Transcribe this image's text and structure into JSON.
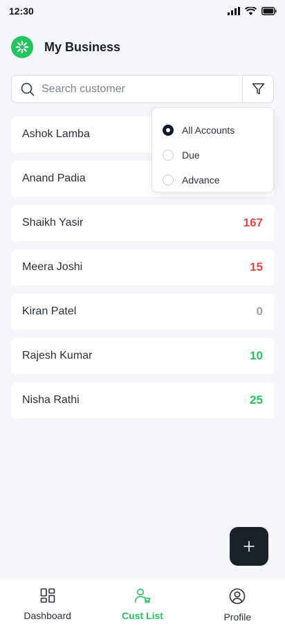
{
  "status_bar": {
    "time": "12:30"
  },
  "header": {
    "title": "My Business"
  },
  "search": {
    "placeholder": "Search customer"
  },
  "customers": [
    {
      "name": "Ashok Lamba"
    },
    {
      "name": "Anand Padia"
    },
    {
      "name": "Shaikh Yasir",
      "amount": "167",
      "status": "due"
    },
    {
      "name": "Meera Joshi",
      "amount": "15",
      "status": "due"
    },
    {
      "name": "Kiran Patel",
      "amount": "0",
      "status": "settled"
    },
    {
      "name": "Rajesh Kumar",
      "amount": "10",
      "status": "advance"
    },
    {
      "name": "Nisha Rathi",
      "amount": "25",
      "status": "advance"
    }
  ],
  "filter_menu": {
    "options": [
      "All Accounts",
      "Due",
      "Advance"
    ],
    "selected": "All Accounts"
  },
  "colors": {
    "due": "#ef4444",
    "advance": "#22c55e",
    "settled": "#9ca3af",
    "accent": "#22c55e",
    "fab": "#1b212b"
  },
  "nav": {
    "items": [
      {
        "label": "Dashboard",
        "icon": "grid-icon"
      },
      {
        "label": "Cust List",
        "icon": "customer-cart-icon",
        "active": true
      },
      {
        "label": "Profile",
        "icon": "user-circle-icon"
      }
    ]
  },
  "fab": {
    "icon": "plus-icon"
  }
}
